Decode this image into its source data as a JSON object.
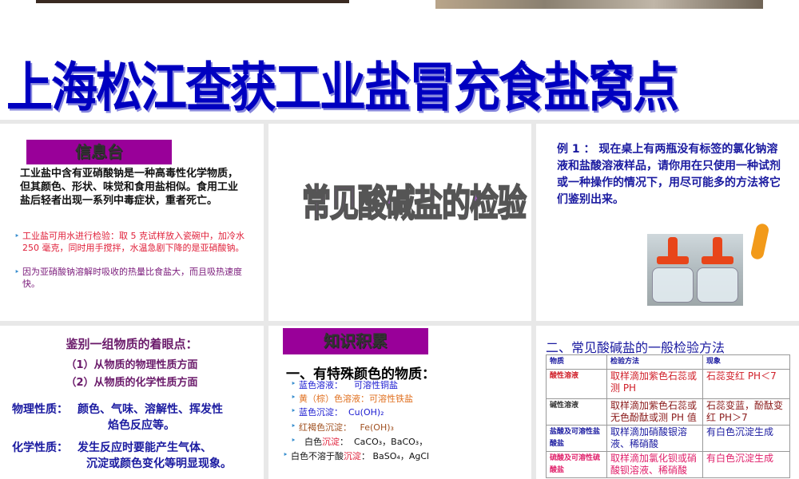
{
  "title": "上海松江查获工业盐冒充食盐窝点",
  "info": {
    "tag": "信息台",
    "text": "工业盐中含有亚硝酸钠是一种高毒性化学物质，但其颜色、形状、味觉和食用盐相似。食用工业盐后轻者出现一系列中毒症状，重者死亡。",
    "bullet1": "工业盐可用水进行检验：取 5 克试样放入瓷碗中，加冷水 250 毫克，同时用手搅拌，水温急剧下降的是亚硝酸钠。",
    "bullet2": "因为亚硝酸钠溶解时吸收的热量比食盐大，而且吸热速度快。"
  },
  "center": {
    "title": "常见酸碱盐的检验"
  },
  "example": {
    "text": "例 1 ： 现在桌上有两瓶没有标签的氯化钠溶液和盐酸溶液样品，请你用在只使用一种试剂或一种操作的情况下，用尽可能多的方法将它们鉴别出来。"
  },
  "points": {
    "heading": "鉴别一组物质的着眼点：",
    "p1": "（1）从物质的物理性质方面",
    "p2": "（2）从物质的化学性质方面",
    "phys_label": "物理性质：",
    "phys1": "颜色、气味、溶解性、挥发性",
    "phys2": "焰色反应等。",
    "chem_label": "化学性质：",
    "chem1": "发生反应时要能产生气体、",
    "chem2": "沉淀或颜色变化等明显现象。"
  },
  "knowledge": {
    "tag": "知识积累",
    "sub": "一、有特殊颜色的物质：",
    "items": [
      {
        "label": "蓝色溶液：",
        "value": "可溶性铜盐"
      },
      {
        "label": "黄（棕）色溶液：",
        "value": "可溶性铁盐"
      },
      {
        "label": "蓝色沉淀：",
        "value": "Cu(OH)₂"
      },
      {
        "label": "红褐色沉淀：",
        "value": "Fe(OH)₃"
      },
      {
        "label": "白色",
        "label_red": "沉淀",
        "label_end": "：",
        "value": "CaCO₃，BaCO₃，"
      },
      {
        "label": "白色不溶于酸",
        "label_red": "沉淀",
        "label_end": "：",
        "value": "BaSO₄，AgCl"
      }
    ]
  },
  "methods": {
    "heading": "二、常见酸碱盐的一般检验方法",
    "headers": [
      "物质",
      "检验方法",
      "现象"
    ],
    "rows": [
      {
        "substance": "酸性溶液",
        "method": "取样滴加紫色石蕊或测 PH",
        "result": "石蕊变红 PH＜7",
        "color": "#d0202a"
      },
      {
        "substance": "碱性溶液",
        "method": "取样滴加紫色石蕊或无色酚酞或测 PH 值",
        "result": "石蕊变蓝，酚酞变红 PH＞7",
        "color": "#8a1a1a"
      },
      {
        "substance": "盐酸及可溶性盐酸盐",
        "method": "取样滴加硝酸银溶液、稀硝酸",
        "result": "有白色沉淀生成",
        "color": "#1a1aa0"
      },
      {
        "substance": "硫酸及可溶性硫酸盐",
        "method": "取样滴加氯化钡或硝酸钡溶液、稀硝酸",
        "result": "有白色沉淀生成",
        "color": "#e0206a"
      }
    ]
  }
}
